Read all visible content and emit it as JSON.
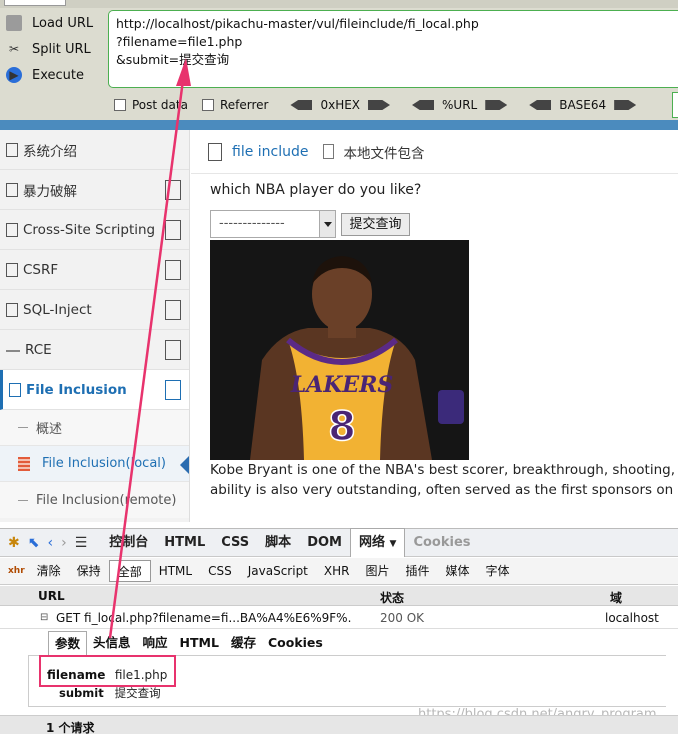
{
  "hackbar": {
    "buttons": [
      "Load URL",
      "Split URL",
      "Execute"
    ],
    "url_text": "http://localhost/pikachu-master/vul/fileinclude/fi_local.php\n?filename=file1.php\n&submit=提交查询",
    "options": {
      "post_data": "Post data",
      "referrer": "Referrer",
      "hex": "0xHEX",
      "url": "%URL",
      "base64": "BASE64"
    }
  },
  "sidebar": {
    "items": [
      {
        "label": "系统介绍"
      },
      {
        "label": "暴力破解"
      },
      {
        "label": "Cross-Site Scripting"
      },
      {
        "label": "CSRF"
      },
      {
        "label": "SQL-Inject"
      },
      {
        "label": "RCE"
      },
      {
        "label": "File Inclusion"
      }
    ],
    "subitems": [
      {
        "label": "概述"
      },
      {
        "label": "File Inclusion(local)"
      },
      {
        "label": "File Inclusion(remote)"
      }
    ]
  },
  "main": {
    "breadcrumb_link": "file include",
    "breadcrumb_text": "本地文件包含",
    "question": "which NBA player do you like?",
    "select_value": "--------------",
    "submit_label": "提交查询",
    "jersey_text": "LAKERS",
    "jersey_number": "8",
    "description_line1": "Kobe Bryant is one of the NBA's best scorer, breakthrough, shooting, free t",
    "description_line2": "ability is also very outstanding, often served as the first sponsors on offens"
  },
  "firebug": {
    "tabs": [
      "控制台",
      "HTML",
      "CSS",
      "脚本",
      "DOM",
      "网络",
      "Cookies"
    ],
    "active_tab": "网络",
    "filters": [
      "清除",
      "保持",
      "全部",
      "HTML",
      "CSS",
      "JavaScript",
      "XHR",
      "图片",
      "插件",
      "媒体",
      "字体"
    ],
    "xhr_icon": "xhr",
    "columns": {
      "url": "URL",
      "status": "状态",
      "domain": "域"
    },
    "request": {
      "url": "GET fi_local.php?filename=fi...BA%A4%E6%9F%.",
      "status": "200 OK",
      "domain": "localhost"
    },
    "subtabs": [
      "参数",
      "头信息",
      "响应",
      "HTML",
      "缓存",
      "Cookies"
    ],
    "params": [
      {
        "key": "filename",
        "value": "file1.php"
      },
      {
        "key": "submit",
        "value": "提交查询"
      }
    ],
    "footer": "1 个请求"
  },
  "watermark": "https://blog.csdn.net/angry_program",
  "colors": {
    "accent": "#1e6fb3",
    "highlight": "#e8336d",
    "hackbar_border": "#4caf50"
  }
}
